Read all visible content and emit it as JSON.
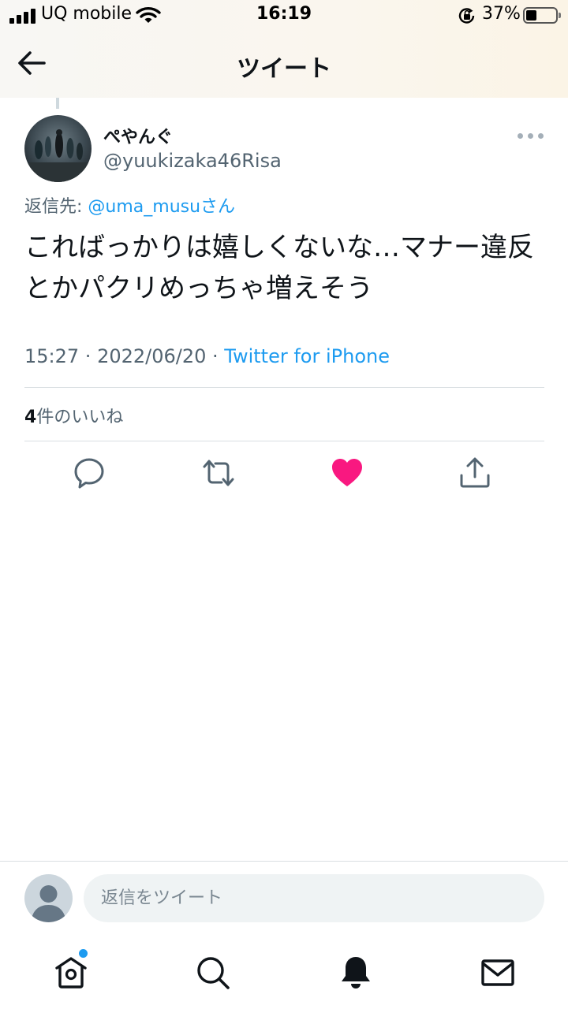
{
  "status_bar": {
    "carrier": "UQ mobile",
    "time": "16:19",
    "battery": "37%",
    "battery_level": 0.37
  },
  "nav": {
    "title": "ツイート"
  },
  "tweet": {
    "display_name": "ぺやんぐ",
    "handle": "@yuukizaka46Risa",
    "reply_prefix": "返信先: ",
    "reply_mention": "@uma_musu",
    "reply_suffix": "さん",
    "text": "こればっかりは嬉しくないな…マナー違反とかパクリめっちゃ増えそう",
    "time": "15:27",
    "sep1": " · ",
    "date": "2022/06/20",
    "sep2": " · ",
    "source": "Twitter for iPhone",
    "likes_count": "4",
    "likes_label": "件のいいね"
  },
  "reply_box": {
    "placeholder": "返信をツイート"
  },
  "colors": {
    "accent": "#1d9bf0",
    "like": "#f91880",
    "secondary_text": "#536471"
  },
  "icons": {
    "back": "arrow-left-icon",
    "more": "more-horizontal-icon",
    "reply": "comment-icon",
    "retweet": "retweet-icon",
    "like": "heart-filled-icon",
    "share": "share-icon",
    "tabs": [
      "home-icon",
      "search-icon",
      "bell-icon",
      "mail-icon"
    ]
  }
}
